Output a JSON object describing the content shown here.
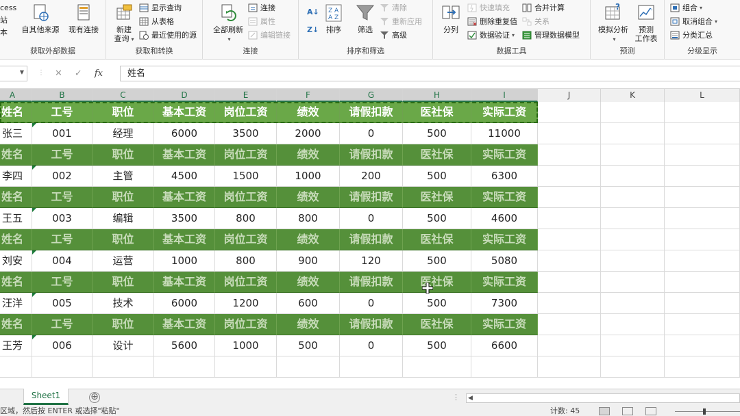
{
  "ribbon": {
    "external_data": {
      "label": "获取外部数据",
      "truncated_top": "cess",
      "truncated_mid": "站",
      "truncated_bot": "本",
      "other_sources": "自其他来源",
      "existing_connections": "现有连接"
    },
    "get_transform": {
      "label": "获取和转换",
      "new_query": "新建",
      "new_query_line2": "查询",
      "show_queries": "显示查询",
      "from_table": "从表格",
      "recent_sources": "最近使用的源"
    },
    "connections": {
      "label": "连接",
      "refresh_all": "全部刷新",
      "connections": "连接",
      "properties": "属性",
      "edit_links": "编辑链接"
    },
    "sort_filter": {
      "label": "排序和筛选",
      "sort": "排序",
      "filter": "筛选",
      "clear": "清除",
      "reapply": "重新应用",
      "advanced": "高级"
    },
    "data_tools": {
      "label": "数据工具",
      "text_to_columns": "分列",
      "flash_fill": "快速填充",
      "remove_duplicates": "删除重复值",
      "data_validation": "数据验证",
      "consolidate": "合并计算",
      "relationships": "关系",
      "manage_model": "管理数据模型"
    },
    "forecast": {
      "label": "预测",
      "what_if": "模拟分析",
      "forecast_sheet": "预测",
      "forecast_sheet_line2": "工作表"
    },
    "outline": {
      "label": "分级显示",
      "group": "组合",
      "ungroup": "取消组合",
      "subtotal": "分类汇总"
    }
  },
  "formula_bar": {
    "cancel": "✕",
    "enter": "✓",
    "fx": "fx",
    "value": "姓名"
  },
  "columns": [
    "A",
    "B",
    "C",
    "D",
    "E",
    "F",
    "G",
    "H",
    "I",
    "J",
    "K",
    "L"
  ],
  "header_row": [
    "姓名",
    "工号",
    "职位",
    "基本工资",
    "岗位工资",
    "绩效",
    "请假扣款",
    "医社保",
    "实际工资"
  ],
  "header_row_truncated": "姓名",
  "header_row_first_visible": "生名",
  "data_rows": [
    [
      "张三",
      "001",
      "经理",
      "6000",
      "3500",
      "2000",
      "0",
      "500",
      "11000"
    ],
    [
      "李四",
      "002",
      "主管",
      "4500",
      "1500",
      "1000",
      "200",
      "500",
      "6300"
    ],
    [
      "王五",
      "003",
      "编辑",
      "3500",
      "800",
      "800",
      "0",
      "500",
      "4600"
    ],
    [
      "刘安",
      "004",
      "运营",
      "1000",
      "800",
      "900",
      "120",
      "500",
      "5080"
    ],
    [
      "汪洋",
      "005",
      "技术",
      "6000",
      "1200",
      "600",
      "0",
      "500",
      "7300"
    ],
    [
      "王芳",
      "006",
      "设计",
      "5600",
      "1000",
      "500",
      "0",
      "500",
      "6600"
    ]
  ],
  "data_rows_visible_first_col": [
    "张三",
    "李四",
    "王五",
    "刘安",
    "汪洋",
    "王芳"
  ],
  "sheet_tab": "Sheet1",
  "add_sheet": "⊕",
  "status": {
    "message": "区域，然后按 ENTER 或选择\"粘贴\"",
    "count_label": "计数: 45"
  },
  "colors": {
    "accent": "#217346",
    "header_green": "#4e8b34",
    "header_green_light": "#6aa848"
  }
}
